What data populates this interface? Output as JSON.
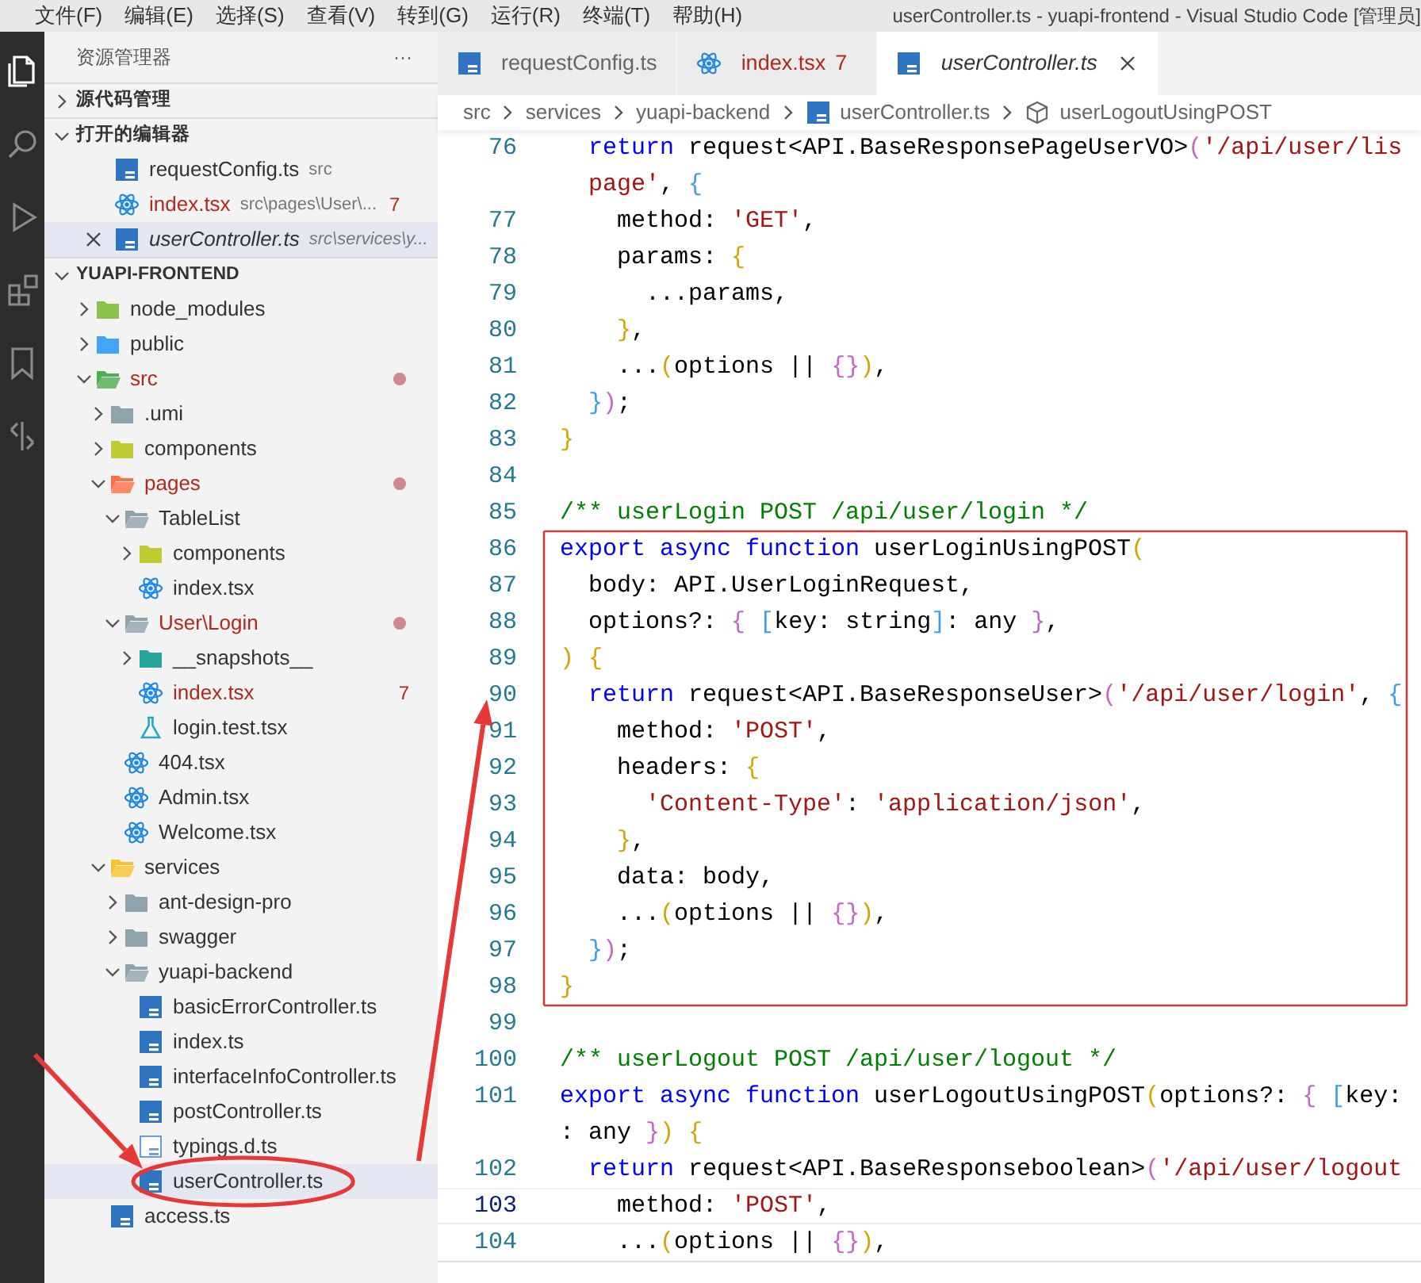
{
  "menu": [
    "文件(F)",
    "编辑(E)",
    "选择(S)",
    "查看(V)",
    "转到(G)",
    "运行(R)",
    "终端(T)",
    "帮助(H)"
  ],
  "window_title": "userController.ts - yuapi-frontend - Visual Studio Code [管理员]",
  "activity_bar": [
    {
      "kind": "files",
      "selected": true
    },
    {
      "kind": "search",
      "selected": false
    },
    {
      "kind": "debug",
      "selected": false
    },
    {
      "kind": "extensions",
      "selected": false
    },
    {
      "kind": "bookmark",
      "selected": false
    },
    {
      "kind": "compare",
      "selected": false
    }
  ],
  "sidebar": {
    "title": "资源管理器",
    "more": "···",
    "source_control": {
      "title": "源代码管理",
      "expanded": false
    },
    "open_editors": {
      "title": "打开的编辑器",
      "expanded": true,
      "items": [
        {
          "kind": "ts",
          "name": "requestConfig.ts",
          "path": "src",
          "has_errors": false,
          "preview": false,
          "selected": false
        },
        {
          "kind": "react",
          "name": "index.tsx",
          "path": "src\\pages\\User\\...",
          "has_errors": true,
          "badge": "7",
          "preview": false,
          "selected": false
        },
        {
          "kind": "ts",
          "name": "userController.ts",
          "path": "src\\services\\y...",
          "has_errors": false,
          "preview": true,
          "selected": true
        }
      ]
    },
    "project": {
      "title": "YUAPI-FRONTEND",
      "expanded": true,
      "tree": [
        {
          "kind": "folder",
          "color": "#8bc34a",
          "name": "node_modules",
          "expanded": false,
          "modified": false,
          "has_errors": false,
          "selected": false
        },
        {
          "kind": "folder",
          "color": "#42a5f5",
          "name": "public",
          "expanded": false,
          "modified": false,
          "has_errors": false,
          "selected": false
        },
        {
          "kind": "folder",
          "color": "#4caf50",
          "name": "src",
          "expanded": true,
          "modified": true,
          "has_errors": false,
          "selected": false,
          "children": [
            {
              "kind": "folder",
              "color": "#90a4ae",
              "name": ".umi",
              "expanded": false,
              "modified": false,
              "has_errors": false,
              "selected": false
            },
            {
              "kind": "folder",
              "color": "#c0ca33",
              "name": "components",
              "expanded": false,
              "modified": false,
              "has_errors": false,
              "selected": false
            },
            {
              "kind": "folder",
              "color": "#ff7043",
              "name": "pages",
              "expanded": true,
              "modified": true,
              "has_errors": false,
              "selected": false,
              "children": [
                {
                  "kind": "folder",
                  "color": "#90a4ae",
                  "name": "TableList",
                  "expanded": true,
                  "modified": false,
                  "has_errors": false,
                  "selected": false,
                  "children": [
                    {
                      "kind": "folder",
                      "color": "#c0ca33",
                      "name": "components",
                      "expanded": false,
                      "modified": false,
                      "has_errors": false,
                      "selected": false
                    },
                    {
                      "kind": "react",
                      "name": "index.tsx",
                      "modified": false,
                      "has_errors": false,
                      "selected": false
                    }
                  ]
                },
                {
                  "kind": "folder",
                  "color": "#90a4ae",
                  "name": "User\\Login",
                  "expanded": true,
                  "modified": true,
                  "has_errors": false,
                  "selected": false,
                  "children": [
                    {
                      "kind": "folder",
                      "color": "#26a69a",
                      "name": "__snapshots__",
                      "expanded": false,
                      "modified": false,
                      "has_errors": false,
                      "selected": false
                    },
                    {
                      "kind": "react",
                      "name": "index.tsx",
                      "modified": false,
                      "has_errors": true,
                      "badge": "7",
                      "selected": false
                    },
                    {
                      "kind": "test",
                      "name": "login.test.tsx",
                      "modified": false,
                      "has_errors": false,
                      "selected": false
                    }
                  ]
                },
                {
                  "kind": "react",
                  "name": "404.tsx",
                  "modified": false,
                  "has_errors": false,
                  "selected": false
                },
                {
                  "kind": "react",
                  "name": "Admin.tsx",
                  "modified": false,
                  "has_errors": false,
                  "selected": false
                },
                {
                  "kind": "react",
                  "name": "Welcome.tsx",
                  "modified": false,
                  "has_errors": false,
                  "selected": false
                }
              ]
            },
            {
              "kind": "folder",
              "color": "#fbc02d",
              "name": "services",
              "expanded": true,
              "modified": false,
              "has_errors": false,
              "selected": false,
              "children": [
                {
                  "kind": "folder",
                  "color": "#90a4ae",
                  "name": "ant-design-pro",
                  "expanded": false,
                  "modified": false,
                  "has_errors": false,
                  "selected": false
                },
                {
                  "kind": "folder",
                  "color": "#90a4ae",
                  "name": "swagger",
                  "expanded": false,
                  "modified": false,
                  "has_errors": false,
                  "selected": false
                },
                {
                  "kind": "folder",
                  "color": "#90a4ae",
                  "name": "yuapi-backend",
                  "expanded": true,
                  "modified": false,
                  "has_errors": false,
                  "selected": false,
                  "children": [
                    {
                      "kind": "ts",
                      "name": "basicErrorController.ts",
                      "modified": false,
                      "has_errors": false,
                      "selected": false
                    },
                    {
                      "kind": "ts",
                      "name": "index.ts",
                      "modified": false,
                      "has_errors": false,
                      "selected": false
                    },
                    {
                      "kind": "ts",
                      "name": "interfaceInfoController.ts",
                      "modified": false,
                      "has_errors": false,
                      "selected": false
                    },
                    {
                      "kind": "ts",
                      "name": "postController.ts",
                      "modified": false,
                      "has_errors": false,
                      "selected": false
                    },
                    {
                      "kind": "dts",
                      "name": "typings.d.ts",
                      "modified": false,
                      "has_errors": false,
                      "selected": false
                    },
                    {
                      "kind": "ts",
                      "name": "userController.ts",
                      "modified": false,
                      "has_errors": false,
                      "selected": true
                    }
                  ]
                }
              ]
            },
            {
              "kind": "ts",
              "name": "access.ts",
              "modified": false,
              "has_errors": false,
              "selected": false
            }
          ]
        }
      ]
    }
  },
  "tabs": [
    {
      "kind": "ts",
      "label": "requestConfig.ts",
      "has_errors": false,
      "preview": false,
      "selected": false
    },
    {
      "kind": "react",
      "label": "index.tsx",
      "has_errors": true,
      "badge": "7",
      "preview": false,
      "selected": false
    },
    {
      "kind": "ts",
      "label": "userController.ts",
      "has_errors": false,
      "preview": true,
      "selected": true
    }
  ],
  "breadcrumb": [
    {
      "kind": "folder",
      "label": "src"
    },
    {
      "kind": "folder",
      "label": "services"
    },
    {
      "kind": "folder",
      "label": "yuapi-backend"
    },
    {
      "kind": "ts",
      "label": "userController.ts"
    },
    {
      "kind": "symbol",
      "label": "userLogoutUsingPOST"
    }
  ],
  "code": [
    {
      "number": "76",
      "boxed": false,
      "current": false,
      "tokens": [
        {
          "kind": "keyword",
          "text": "  return"
        },
        {
          "kind": "plain",
          "text": " request<API.BaseResponsePageUserVO>"
        },
        {
          "kind": "bracket2",
          "text": "("
        },
        {
          "kind": "string",
          "text": "'/api/user/lis"
        }
      ]
    },
    {
      "boxed": false,
      "current": false,
      "tokens": [
        {
          "kind": "string",
          "text": "  page'"
        },
        {
          "kind": "plain",
          "text": ", "
        },
        {
          "kind": "bracket3",
          "text": "{"
        }
      ]
    },
    {
      "number": "77",
      "boxed": false,
      "current": false,
      "tokens": [
        {
          "kind": "plain",
          "text": "    method: "
        },
        {
          "kind": "string",
          "text": "'GET'"
        },
        {
          "kind": "plain",
          "text": ","
        }
      ]
    },
    {
      "number": "78",
      "boxed": false,
      "current": false,
      "tokens": [
        {
          "kind": "plain",
          "text": "    params: "
        },
        {
          "kind": "bracket1",
          "text": "{"
        }
      ]
    },
    {
      "number": "79",
      "boxed": false,
      "current": false,
      "tokens": [
        {
          "kind": "plain",
          "text": "      ...params,"
        }
      ]
    },
    {
      "number": "80",
      "boxed": false,
      "current": false,
      "tokens": [
        {
          "kind": "bracket1",
          "text": "    }"
        },
        {
          "kind": "plain",
          "text": ","
        }
      ]
    },
    {
      "number": "81",
      "boxed": false,
      "current": false,
      "tokens": [
        {
          "kind": "plain",
          "text": "    ..."
        },
        {
          "kind": "bracket1",
          "text": "("
        },
        {
          "kind": "plain",
          "text": "options || "
        },
        {
          "kind": "bracket2",
          "text": "{}"
        },
        {
          "kind": "bracket1",
          "text": ")"
        },
        {
          "kind": "plain",
          "text": ","
        }
      ]
    },
    {
      "number": "82",
      "boxed": false,
      "current": false,
      "tokens": [
        {
          "kind": "bracket3",
          "text": "  }"
        },
        {
          "kind": "bracket2",
          "text": ")"
        },
        {
          "kind": "plain",
          "text": ";"
        }
      ]
    },
    {
      "number": "83",
      "boxed": false,
      "current": false,
      "tokens": [
        {
          "kind": "bracket1",
          "text": "}"
        }
      ]
    },
    {
      "number": "84",
      "boxed": false,
      "current": false
    },
    {
      "number": "85",
      "boxed": false,
      "current": false,
      "tokens": [
        {
          "kind": "comment",
          "text": "/** userLogin POST /api/user/login */"
        }
      ]
    },
    {
      "number": "86",
      "boxed": true,
      "current": false,
      "tokens": [
        {
          "kind": "keyword",
          "text": "export async function"
        },
        {
          "kind": "plain",
          "text": " userLoginUsingPOST"
        },
        {
          "kind": "bracket1",
          "text": "("
        }
      ]
    },
    {
      "number": "87",
      "boxed": true,
      "current": false,
      "tokens": [
        {
          "kind": "plain",
          "text": "  body: API.UserLoginRequest,"
        }
      ]
    },
    {
      "number": "88",
      "boxed": true,
      "current": false,
      "tokens": [
        {
          "kind": "plain",
          "text": "  options?: "
        },
        {
          "kind": "bracket2",
          "text": "{ "
        },
        {
          "kind": "bracket3",
          "text": "["
        },
        {
          "kind": "plain",
          "text": "key: string"
        },
        {
          "kind": "bracket3",
          "text": "]"
        },
        {
          "kind": "plain",
          "text": ": any "
        },
        {
          "kind": "bracket2",
          "text": "}"
        },
        {
          "kind": "plain",
          "text": ","
        }
      ]
    },
    {
      "number": "89",
      "boxed": true,
      "current": false,
      "tokens": [
        {
          "kind": "bracket1",
          "text": ") {"
        }
      ]
    },
    {
      "number": "90",
      "boxed": true,
      "current": false,
      "tokens": [
        {
          "kind": "keyword",
          "text": "  return"
        },
        {
          "kind": "plain",
          "text": " request<API.BaseResponseUser>"
        },
        {
          "kind": "bracket2",
          "text": "("
        },
        {
          "kind": "string",
          "text": "'/api/user/login'"
        },
        {
          "kind": "plain",
          "text": ", "
        },
        {
          "kind": "bracket3",
          "text": "{"
        }
      ]
    },
    {
      "number": "91",
      "boxed": true,
      "current": false,
      "tokens": [
        {
          "kind": "plain",
          "text": "    method: "
        },
        {
          "kind": "string",
          "text": "'POST'"
        },
        {
          "kind": "plain",
          "text": ","
        }
      ]
    },
    {
      "number": "92",
      "boxed": true,
      "current": false,
      "tokens": [
        {
          "kind": "plain",
          "text": "    headers: "
        },
        {
          "kind": "bracket1",
          "text": "{"
        }
      ]
    },
    {
      "number": "93",
      "boxed": true,
      "current": false,
      "tokens": [
        {
          "kind": "string",
          "text": "      'Content-Type'"
        },
        {
          "kind": "plain",
          "text": ": "
        },
        {
          "kind": "string",
          "text": "'application/json'"
        },
        {
          "kind": "plain",
          "text": ","
        }
      ]
    },
    {
      "number": "94",
      "boxed": true,
      "current": false,
      "tokens": [
        {
          "kind": "bracket1",
          "text": "    }"
        },
        {
          "kind": "plain",
          "text": ","
        }
      ]
    },
    {
      "number": "95",
      "boxed": true,
      "current": false,
      "tokens": [
        {
          "kind": "plain",
          "text": "    data: body,"
        }
      ]
    },
    {
      "number": "96",
      "boxed": true,
      "current": false,
      "tokens": [
        {
          "kind": "plain",
          "text": "    ..."
        },
        {
          "kind": "bracket1",
          "text": "("
        },
        {
          "kind": "plain",
          "text": "options || "
        },
        {
          "kind": "bracket2",
          "text": "{}"
        },
        {
          "kind": "bracket1",
          "text": ")"
        },
        {
          "kind": "plain",
          "text": ","
        }
      ]
    },
    {
      "number": "97",
      "boxed": true,
      "current": false,
      "tokens": [
        {
          "kind": "bracket3",
          "text": "  }"
        },
        {
          "kind": "bracket2",
          "text": ")"
        },
        {
          "kind": "plain",
          "text": ";"
        }
      ]
    },
    {
      "number": "98",
      "boxed": true,
      "current": false,
      "tokens": [
        {
          "kind": "bracket1",
          "text": "}"
        }
      ]
    },
    {
      "number": "99",
      "boxed": false,
      "current": false
    },
    {
      "number": "100",
      "boxed": false,
      "current": false,
      "tokens": [
        {
          "kind": "comment",
          "text": "/** userLogout POST /api/user/logout */"
        }
      ]
    },
    {
      "number": "101",
      "boxed": false,
      "current": false,
      "tokens": [
        {
          "kind": "keyword",
          "text": "export async function"
        },
        {
          "kind": "plain",
          "text": " userLogoutUsingPOST"
        },
        {
          "kind": "bracket1",
          "text": "("
        },
        {
          "kind": "plain",
          "text": "options?: "
        },
        {
          "kind": "bracket2",
          "text": "{ "
        },
        {
          "kind": "bracket3",
          "text": "["
        },
        {
          "kind": "plain",
          "text": "key:"
        }
      ]
    },
    {
      "boxed": false,
      "current": false,
      "tokens": [
        {
          "kind": "plain",
          "text": ": any "
        },
        {
          "kind": "bracket2",
          "text": "}"
        },
        {
          "kind": "bracket1",
          "text": ") {"
        }
      ]
    },
    {
      "number": "102",
      "boxed": false,
      "current": false,
      "tokens": [
        {
          "kind": "keyword",
          "text": "  return"
        },
        {
          "kind": "plain",
          "text": " request<API.BaseResponseboolean>"
        },
        {
          "kind": "bracket2",
          "text": "("
        },
        {
          "kind": "string",
          "text": "'/api/user/logout"
        }
      ]
    },
    {
      "number": "103",
      "boxed": false,
      "current": true,
      "tokens": [
        {
          "kind": "plain",
          "text": "    method: "
        },
        {
          "kind": "string",
          "text": "'POST'"
        },
        {
          "kind": "plain",
          "text": ","
        }
      ]
    },
    {
      "number": "104",
      "boxed": false,
      "current": false,
      "tokens": [
        {
          "kind": "plain",
          "text": "    ..."
        },
        {
          "kind": "bracket1",
          "text": "("
        },
        {
          "kind": "plain",
          "text": "options || "
        },
        {
          "kind": "bracket2",
          "text": "{}"
        },
        {
          "kind": "bracket1",
          "text": ")"
        },
        {
          "kind": "plain",
          "text": ","
        }
      ]
    }
  ],
  "annotations": [
    {
      "kind": "frame"
    },
    {
      "kind": "ellipse"
    },
    {
      "kind": "arrow"
    },
    {
      "kind": "arrow"
    }
  ]
}
